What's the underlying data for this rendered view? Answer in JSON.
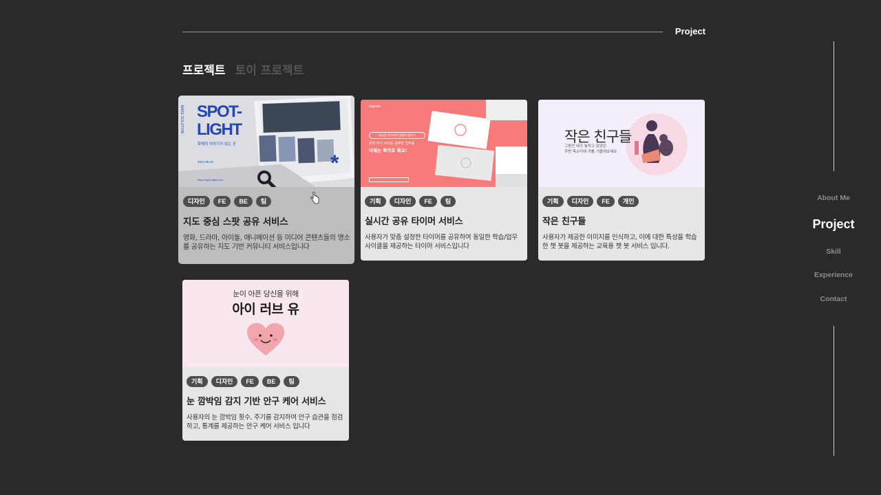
{
  "section": {
    "title": "Project"
  },
  "tabs": [
    {
      "label": "프로젝트",
      "active": true
    },
    {
      "label": "토이 프로젝트",
      "active": false
    }
  ],
  "cards": [
    {
      "tags": [
        "디자인",
        "FE",
        "BE",
        "팀"
      ],
      "name": "지도 중심 스팟 공유 서비스",
      "desc": "영화, 드라마, 아이돌, 애니메이션 등 미디어 콘텐츠들의 명소를 공유하는 지도 기반 커뮤니티 서비스입니다",
      "thumb": {
        "title_line1": "SPOT-",
        "title_line2": "LIGHT",
        "subtitle": "화제의 이야기가 있는 곳",
        "date": "2024.08.10",
        "side": "MAKE SOLUTION",
        "footer": "https://spot-light.com"
      }
    },
    {
      "tags": [
        "기획",
        "디자인",
        "FE",
        "팀"
      ],
      "name": "실시간 공유 타이머 서비스",
      "desc": "사용자가 맞춤 설정한 타이머를 공유하여 동일한 학습/업무 사이클을 제공하는 타이머 서비스입니다",
      "thumb": {
        "logo": "pagoda",
        "pill": "실시간 타이머로 집중력 올리기",
        "line1": "혼자 하기 어려운 공부와 업무를",
        "line2": "이제는 뽀각로 해요!"
      }
    },
    {
      "tags": [
        "기획",
        "디자인",
        "FE",
        "개인"
      ],
      "name": "작은 친구들",
      "desc": "사용자가 제공한 이미지를 인식하고, 이에 대한 특성을 학습한 챗 봇을 제공하는 교육용 챗 봇 서비스 입니다.",
      "thumb": {
        "title": "작은 친구들",
        "sub1": "그동안 내가 놓치고 있었던",
        "sub2": "주변 목소리에 귀를 기울여보세요"
      }
    },
    {
      "tags": [
        "기획",
        "디자인",
        "FE",
        "BE",
        "팀"
      ],
      "name": "눈 깜박임 감지 기반 안구 케어 서비스",
      "desc": "사용자의 눈 깜박임 횟수, 주기를 감지하여 안구 습관을 점검하고, 통계를 제공하는 안구 케어 서비스 입니다",
      "thumb": {
        "sub": "눈이 아픈 당신을 위해",
        "title": "아이 러브 유"
      }
    }
  ],
  "nav": [
    {
      "label": "About Me",
      "active": false
    },
    {
      "label": "Project",
      "active": true
    },
    {
      "label": "Skill",
      "active": false
    },
    {
      "label": "Experience",
      "active": false
    },
    {
      "label": "Contact",
      "active": false
    }
  ],
  "colors": {
    "background": "#2a2a2a",
    "card": "#e6e6e6",
    "card_hover": "#bdbdbd",
    "tag": "#4e4e4e",
    "coral": "#f77a7a",
    "lavender": "#f3eef9",
    "pink": "#f9e7ef"
  },
  "icons": [
    "search-icon",
    "asterisk-icon",
    "heart-icon",
    "cursor-icon"
  ]
}
